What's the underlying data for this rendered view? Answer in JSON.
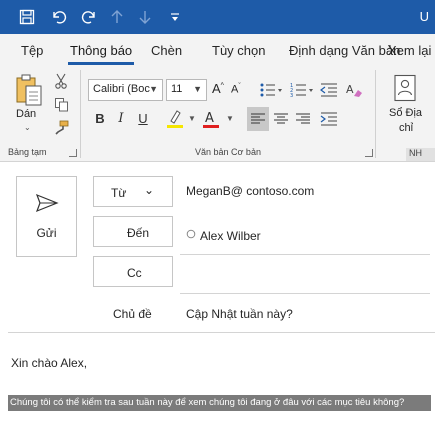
{
  "title_bar": {
    "title_fragment": "U"
  },
  "tabs": [
    {
      "label": "Tệp"
    },
    {
      "label": "Thông báo"
    },
    {
      "label": "Chèn"
    },
    {
      "label": "Tùy chọn"
    },
    {
      "label": "Định dạng Văn bản"
    },
    {
      "label": "Xem lại"
    }
  ],
  "ribbon": {
    "clipboard": {
      "paste_label": "Dán",
      "group_label": "Bảng tạm"
    },
    "basic_text": {
      "font_name": "Calibri (Boc",
      "font_size": "11",
      "group_label": "Văn bản Cơ bản",
      "bold": "B",
      "italic": "I",
      "underline": "U"
    },
    "address_book": {
      "label_line1": "Sổ Địa",
      "label_line2": "chỉ"
    },
    "names_group_label": "NH"
  },
  "compose": {
    "send_label": "Gửi",
    "from_label": "Từ",
    "from_value": "MeganB@ contoso.com",
    "to_label": "Đến",
    "to_value": "Alex Wilber",
    "cc_label": "Cc",
    "subject_label": "Chủ đề",
    "subject_value": "Cập Nhật tuần này?"
  },
  "message_body": {
    "greeting": "Xin chào Alex,",
    "selected_line": "Chúng tôi có thể kiểm tra sau tuần này để xem chúng tôi đang ở đâu với các mục tiêu không?"
  },
  "colors": {
    "titlebar": "#1e5ba8",
    "highlight_color": "#f5e600",
    "font_color": "#e02020",
    "selection_bg": "#7b7b7b"
  }
}
